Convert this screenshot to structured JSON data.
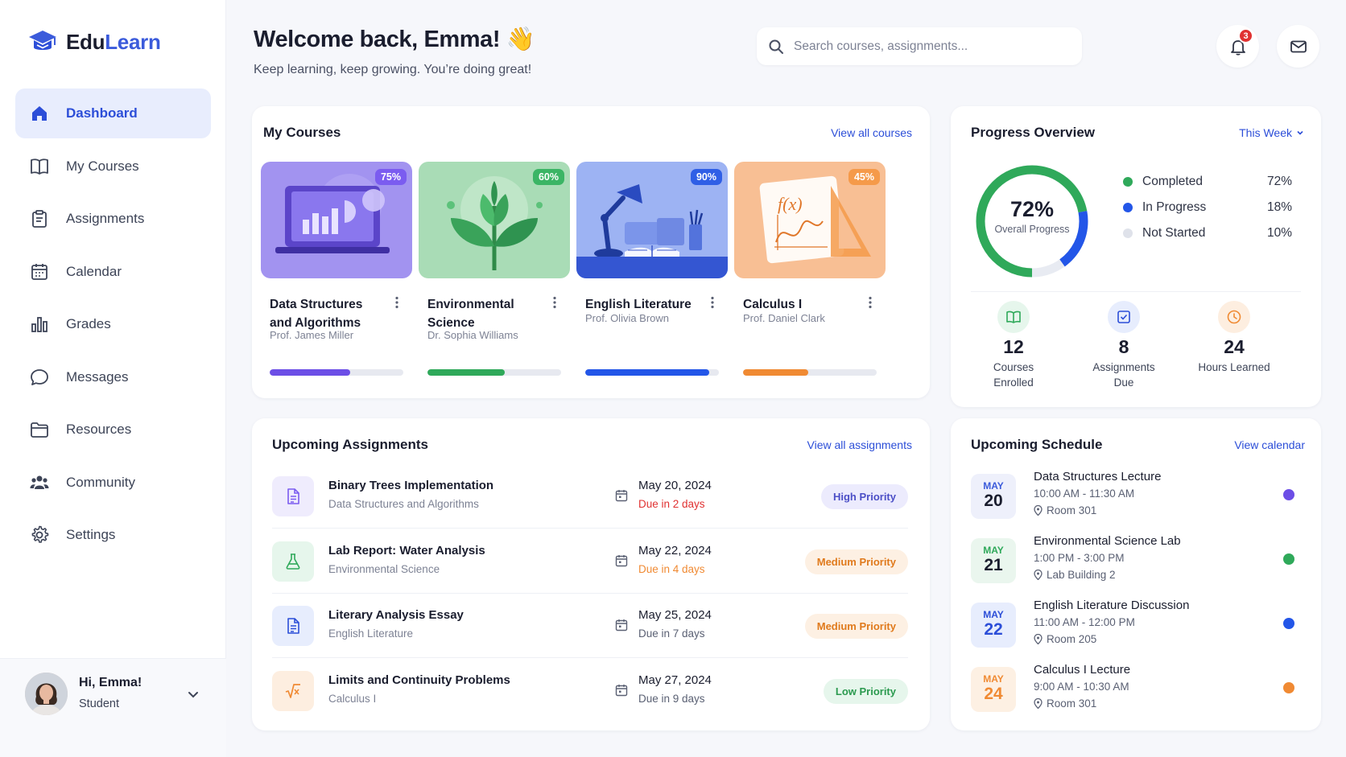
{
  "brand": {
    "part1": "Edu",
    "part2": "Learn",
    "accent": "#3b5bdb"
  },
  "sidebar": {
    "items": [
      {
        "label": "Dashboard",
        "icon": "home-icon",
        "active": true
      },
      {
        "label": "My Courses",
        "icon": "book-icon"
      },
      {
        "label": "Assignments",
        "icon": "clipboard-icon"
      },
      {
        "label": "Calendar",
        "icon": "calendar-icon"
      },
      {
        "label": "Grades",
        "icon": "bar-chart-icon"
      },
      {
        "label": "Messages",
        "icon": "chat-icon"
      },
      {
        "label": "Resources",
        "icon": "folder-icon"
      },
      {
        "label": "Community",
        "icon": "users-icon"
      },
      {
        "label": "Settings",
        "icon": "gear-icon"
      }
    ]
  },
  "user": {
    "greeting": "Hi, Emma!",
    "role": "Student"
  },
  "header": {
    "welcome": "Welcome back, Emma!",
    "wave": "👋",
    "subtitle": "Keep learning, keep growing. You’re doing great!",
    "search_placeholder": "Search courses, assignments...",
    "notification_count": "3"
  },
  "courses": {
    "title": "My Courses",
    "link": "View all courses",
    "items": [
      {
        "name": "Data Structures and Algorithms",
        "prof": "Prof. James Miller",
        "pct_label": "75%",
        "progress": 0.6,
        "color": "#6c4ee6",
        "badge": "#7b5cf0",
        "theme": "laptop"
      },
      {
        "name": "Environmental Science",
        "prof": "Dr. Sophia Williams",
        "pct_label": "60%",
        "progress": 0.58,
        "color": "#2fa95a",
        "badge": "#3bb565",
        "theme": "plant"
      },
      {
        "name": "English Literature",
        "prof": "Prof. Olivia Brown",
        "pct_label": "90%",
        "progress": 0.93,
        "color": "#2356e8",
        "badge": "#2f5fe6",
        "theme": "lamp"
      },
      {
        "name": "Calculus I",
        "prof": "Prof. Daniel Clark",
        "pct_label": "45%",
        "progress": 0.49,
        "color": "#f08a33",
        "badge": "#f59a4a",
        "theme": "math"
      }
    ]
  },
  "progress": {
    "title": "Progress Overview",
    "period": "This Week",
    "overall_value": "72%",
    "overall_label": "Overall Progress",
    "legend": [
      {
        "label": "Completed",
        "value": "72%",
        "color": "#2fa95a",
        "fraction": 0.72
      },
      {
        "label": "In Progress",
        "value": "18%",
        "color": "#2356e8",
        "fraction": 0.18
      },
      {
        "label": "Not Started",
        "value": "10%",
        "color": "#e3e6ee",
        "fraction": 0.1
      }
    ],
    "stats": [
      {
        "num": "12",
        "label": "Courses Enrolled",
        "icon": "book-open-icon",
        "color": "#2fa95a",
        "bg": "#e6f6ec"
      },
      {
        "num": "8",
        "label": "Assignments Due",
        "icon": "checklist-icon",
        "color": "#2c4ed8",
        "bg": "#e7edfd"
      },
      {
        "num": "24",
        "label": "Hours Learned",
        "icon": "clock-icon",
        "color": "#f08a33",
        "bg": "#fdeee0"
      }
    ]
  },
  "assignments": {
    "title": "Upcoming Assignments",
    "link": "View all assignments",
    "items": [
      {
        "title": "Binary Trees Implementation",
        "course": "Data Structures and Algorithms",
        "date": "May 20, 2024",
        "due": "Due in 2 days",
        "due_color": "#e03131",
        "priority": "High Priority",
        "p_color": "#4c4fc7",
        "p_bg": "#ecebfd",
        "icon": "document-icon",
        "ic_color": "#7b5cf0",
        "ic_bg": "#efecfd"
      },
      {
        "title": "Lab Report: Water Analysis",
        "course": "Environmental Science",
        "date": "May 22, 2024",
        "due": "Due in 4 days",
        "due_color": "#f08a33",
        "priority": "Medium Priority",
        "p_color": "#e07a1c",
        "p_bg": "#fdf0e3",
        "icon": "flask-icon",
        "ic_color": "#2fa95a",
        "ic_bg": "#e6f6ec"
      },
      {
        "title": "Literary Analysis Essay",
        "course": "English Literature",
        "date": "May 25, 2024",
        "due": "Due in 7 days",
        "due_color": "#5a6073",
        "priority": "Medium Priority",
        "p_color": "#e07a1c",
        "p_bg": "#fdf0e3",
        "icon": "document-icon",
        "ic_color": "#2c4ed8",
        "ic_bg": "#e7edfd"
      },
      {
        "title": "Limits and Continuity Problems",
        "course": "Calculus I",
        "date": "May 27, 2024",
        "due": "Due in 9 days",
        "due_color": "#5a6073",
        "priority": "Low Priority",
        "p_color": "#2b9a4f",
        "p_bg": "#e6f6ec",
        "icon": "sqrt-icon",
        "ic_color": "#f08a33",
        "ic_bg": "#fdeee0"
      }
    ]
  },
  "schedule": {
    "title": "Upcoming Schedule",
    "link": "View calendar",
    "items": [
      {
        "month": "MAY",
        "day": "20",
        "title": "Data Structures Lecture",
        "time": "10:00 AM - 11:30 AM",
        "room": "Room 301",
        "color": "#6c4ee6",
        "bg": "#eef0fb",
        "m_color": "#3b5bdb",
        "d_color": "#1a1d2e"
      },
      {
        "month": "MAY",
        "day": "21",
        "title": "Environmental Science Lab",
        "time": "1:00 PM - 3:00 PM",
        "room": "Lab Building 2",
        "color": "#2fa95a",
        "bg": "#eaf6ee",
        "m_color": "#2fa95a",
        "d_color": "#1a1d2e"
      },
      {
        "month": "MAY",
        "day": "22",
        "title": "English Literature Discussion",
        "time": "11:00 AM - 12:00 PM",
        "room": "Room 205",
        "color": "#2356e8",
        "bg": "#e7edfd",
        "m_color": "#2c4ed8",
        "d_color": "#2c4ed8"
      },
      {
        "month": "MAY",
        "day": "24",
        "title": "Calculus I Lecture",
        "time": "9:00 AM - 10:30 AM",
        "room": "Room 301",
        "color": "#f08a33",
        "bg": "#fdf0e3",
        "m_color": "#f08a33",
        "d_color": "#f08a33"
      }
    ]
  }
}
